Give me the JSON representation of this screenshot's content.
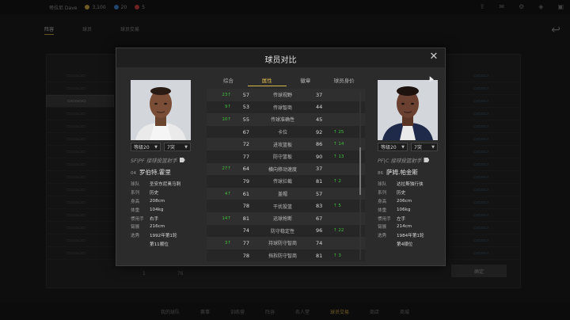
{
  "background": {
    "topbar": {
      "username": "帝拉尼 Dave",
      "coins": "3,100",
      "gems": "20",
      "tickets": "5"
    },
    "tabs": [
      "阵容",
      "球员",
      "球员交易"
    ],
    "bottom_nav": [
      "我的球队",
      "赛事",
      "训练营",
      "阵容",
      "名人堂",
      "球员交易",
      "商店",
      "商城"
    ],
    "bottom_nav_active": 5,
    "list_count": 15,
    "right_count": 15,
    "pagination": {
      "current": "1",
      "total": "76"
    },
    "action_button": "确定"
  },
  "modal": {
    "title": "球员对比",
    "close_label": "✕",
    "tabs": [
      "综合",
      "属性",
      "徽章",
      "球员身价"
    ],
    "active_tab": 1,
    "left_player": {
      "level": "等级20",
      "rating": "7突",
      "position": "SF|PF 接球投篮射手",
      "number": "04",
      "name": "罗伯特.霍里",
      "info": [
        {
          "k": "球队",
          "v": "圣安东尼奥马刺"
        },
        {
          "k": "系列",
          "v": "历史"
        },
        {
          "k": "身高",
          "v": "208cm"
        },
        {
          "k": "体重",
          "v": "104kg"
        },
        {
          "k": "惯用手",
          "v": "右手"
        },
        {
          "k": "臂展",
          "v": "216cm"
        },
        {
          "k": "选秀",
          "v": "1992年第1轮"
        },
        {
          "k": "",
          "v": "第11顺位"
        }
      ]
    },
    "right_player": {
      "level": "等级20",
      "rating": "7突",
      "position": "PF|C 接球投篮射手",
      "number": "86",
      "name": "萨姆.帕金斯",
      "info": [
        {
          "k": "球队",
          "v": "达拉斯独行侠"
        },
        {
          "k": "系列",
          "v": "历史"
        },
        {
          "k": "身高",
          "v": "206cm"
        },
        {
          "k": "体重",
          "v": "106kg"
        },
        {
          "k": "惯用手",
          "v": "左手"
        },
        {
          "k": "臂展",
          "v": "214cm"
        },
        {
          "k": "选秀",
          "v": "1984年第1轮"
        },
        {
          "k": "",
          "v": "第4顺位"
        }
      ]
    },
    "stats": [
      {
        "lb": "23↑",
        "lv": "57",
        "name": "传球视野",
        "rv": "37",
        "rb": ""
      },
      {
        "lb": "9↑",
        "lv": "53",
        "name": "传球智商",
        "rv": "44",
        "rb": ""
      },
      {
        "lb": "10↑",
        "lv": "55",
        "name": "传球准确性",
        "rv": "45",
        "rb": ""
      },
      {
        "lb": "",
        "lv": "67",
        "name": "卡位",
        "rv": "92",
        "rb": "↑ 25"
      },
      {
        "lb": "",
        "lv": "72",
        "name": "进攻篮板",
        "rv": "86",
        "rb": "↑ 14"
      },
      {
        "lb": "",
        "lv": "77",
        "name": "防守篮板",
        "rv": "90",
        "rb": "↑ 13"
      },
      {
        "lb": "27↑",
        "lv": "64",
        "name": "横向移动速度",
        "rv": "37",
        "rb": ""
      },
      {
        "lb": "",
        "lv": "79",
        "name": "传球拦截",
        "rv": "81",
        "rb": "↑ 2"
      },
      {
        "lb": "4↑",
        "lv": "61",
        "name": "盖帽",
        "rv": "57",
        "rb": ""
      },
      {
        "lb": "",
        "lv": "78",
        "name": "干扰投篮",
        "rv": "83",
        "rb": "↑ 5"
      },
      {
        "lb": "14↑",
        "lv": "81",
        "name": "运球抢断",
        "rv": "67",
        "rb": ""
      },
      {
        "lb": "",
        "lv": "74",
        "name": "防守稳定性",
        "rv": "96",
        "rb": "↑ 22"
      },
      {
        "lb": "3↑",
        "lv": "77",
        "name": "持球防守智商",
        "rv": "74",
        "rb": ""
      },
      {
        "lb": "",
        "lv": "78",
        "name": "挡拆防守智商",
        "rv": "81",
        "rb": "↑ 3"
      },
      {
        "lb": "",
        "lv": "79",
        "name": "协防智商",
        "rv": "84",
        "rb": "↑ 5"
      }
    ]
  },
  "colors": {
    "accent": "#d9b64a",
    "increase": "#3fbf3f",
    "bg": "#2b2b2b"
  }
}
